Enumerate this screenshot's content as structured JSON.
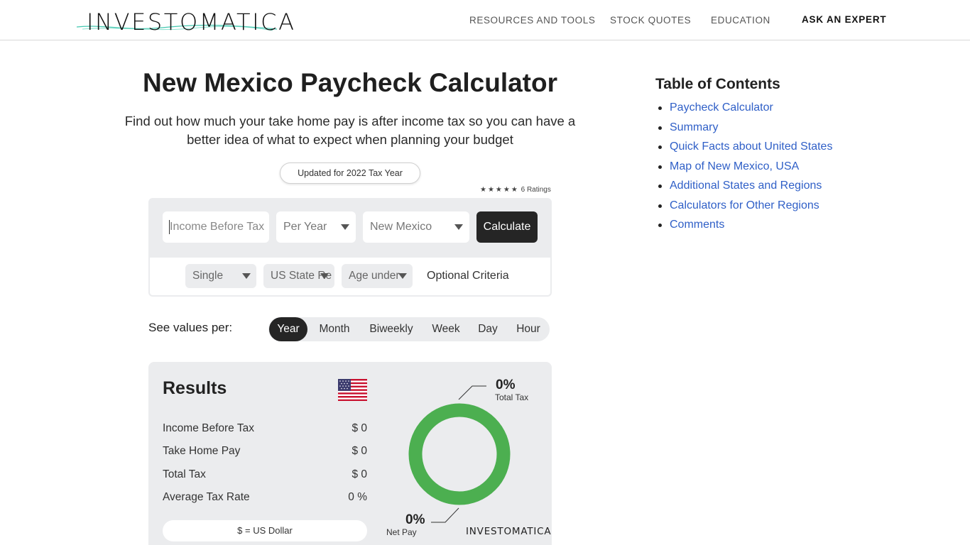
{
  "header": {
    "logo_text": "INVESTOMATICA",
    "nav": [
      "RESOURCES AND TOOLS",
      "STOCK QUOTES",
      "EDUCATION"
    ],
    "ask_expert": "ASK AN EXPERT"
  },
  "main": {
    "title": "New Mexico Paycheck Calculator",
    "subtitle": "Find out how much your take home pay is after income tax so you can have a better idea of what to expect when planning your budget",
    "updated_badge": "Updated for 2022 Tax Year",
    "ratings": {
      "stars": "★★★★★",
      "label": "6 Ratings"
    }
  },
  "calculator": {
    "income_placeholder": "Income Before Tax",
    "frequency_value": "Per Year",
    "region_value": "New Mexico",
    "calculate_label": "Calculate",
    "filing_value": "Single",
    "residency_value": "US State Re",
    "age_value": "Age under",
    "optional_label": "Optional Criteria"
  },
  "periods": {
    "label": "See values per:",
    "options": [
      "Year",
      "Month",
      "Biweekly",
      "Week",
      "Day",
      "Hour"
    ],
    "active": "Year"
  },
  "results": {
    "title": "Results",
    "rows": [
      {
        "label": "Income Before Tax",
        "value": "$ 0"
      },
      {
        "label": "Take Home Pay",
        "value": "$ 0"
      },
      {
        "label": "Total Tax",
        "value": "$ 0"
      },
      {
        "label": "Average Tax Rate",
        "value": "0 %"
      }
    ],
    "currency_note": "$ = US Dollar",
    "chart": {
      "total_tax_pct": "0%",
      "total_tax_label": "Total Tax",
      "net_pay_pct": "0%",
      "net_pay_label": "Net Pay",
      "ring_color": "#4caf50"
    },
    "brand": "INVESTOMATICA"
  },
  "toc": {
    "title": "Table of Contents",
    "items": [
      "Paycheck Calculator",
      "Summary",
      "Quick Facts about United States",
      "Map of New Mexico, USA",
      "Additional States and Regions",
      "Calculators for Other Regions",
      "Comments"
    ]
  },
  "colors": {
    "accent_dark": "#252525",
    "panel_gray": "#ebecee",
    "link_blue": "#2f5fc7",
    "donut_green": "#4caf50",
    "logo_teal": "#43c8b0"
  }
}
